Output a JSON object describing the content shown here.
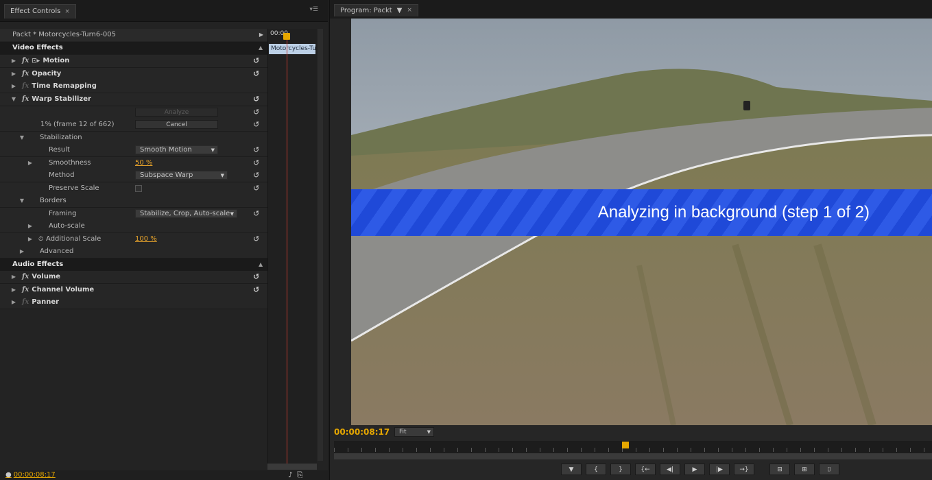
{
  "effect_controls": {
    "tab_label": "Effect Controls",
    "tab_close": "×",
    "panel_menu": "▾☰",
    "clip_header": "Packt * Motorcycles-Turn6-005",
    "mini_time": "00:00",
    "mini_clip": "Motorcycles-Turn",
    "video_effects_label": "Video Effects",
    "motion_label": "Motion",
    "opacity_label": "Opacity",
    "time_remap_label": "Time Remapping",
    "warp_label": "Warp Stabilizer",
    "analyze_label": "Analyze",
    "progress_text": "1% (frame 12 of 662)",
    "cancel_label": "Cancel",
    "stabilization_label": "Stabilization",
    "result_label": "Result",
    "result_value": "Smooth Motion",
    "smoothness_label": "Smoothness",
    "smoothness_value": "50 %",
    "method_label": "Method",
    "method_value": "Subspace Warp",
    "preserve_label": "Preserve Scale",
    "borders_label": "Borders",
    "framing_label": "Framing",
    "framing_value": "Stabilize, Crop, Auto-scale",
    "autoscale_label": "Auto-scale",
    "additional_scale_label": "Additional Scale",
    "additional_scale_value": "100 %",
    "advanced_label": "Advanced",
    "audio_effects_label": "Audio Effects",
    "volume_label": "Volume",
    "channel_volume_label": "Channel Volume",
    "panner_label": "Panner",
    "timecode": "00:00:08:17"
  },
  "program_monitor": {
    "tab_label": "Program: Packt",
    "tab_menu": "▼",
    "tab_close": "×",
    "banner_text": "Analyzing in background (step 1 of 2)",
    "timecode": "00:00:08:17",
    "fit_label": "Fit"
  },
  "icons": {
    "fx": "fx",
    "reset": "↺",
    "expand": "▶",
    "collapse": "▼",
    "caret_up": "▲",
    "dropdown": "▼",
    "stopwatch": "⏱",
    "marker": "▼",
    "in": "{",
    "out": "}",
    "go_in": "{←",
    "step_back": "◀|",
    "play": "▶",
    "step_fwd": "|▶",
    "go_out": "→}",
    "lift": "⊟",
    "extract": "⊞",
    "camera": "⌷",
    "export": "⎘",
    "audio": "♪"
  },
  "colors": {
    "accent_timecode": "#e6a700",
    "banner_blue": "#1f49d8",
    "playhead_red": "#c23a2e"
  }
}
